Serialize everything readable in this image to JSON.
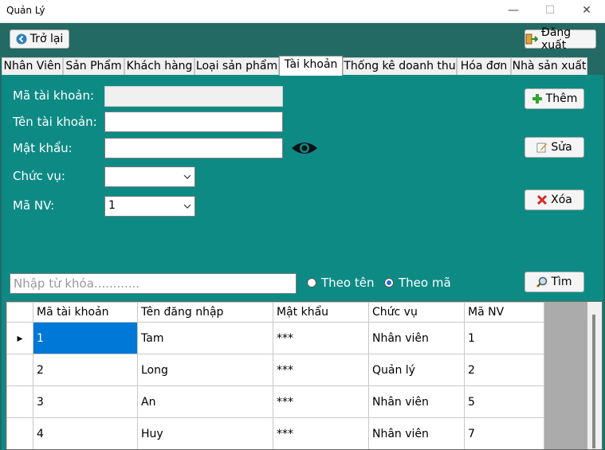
{
  "window": {
    "title": "Quản Lý",
    "minimize": "—",
    "maximize": "☐",
    "close": "✕"
  },
  "toolbar": {
    "back_label": "Trở lại",
    "logout_label": "Đăng xuất"
  },
  "tabs": [
    {
      "label": "Nhân Viên"
    },
    {
      "label": "Sản Phẩm"
    },
    {
      "label": "Khách hàng"
    },
    {
      "label": "Loại sản phẩm"
    },
    {
      "label": "Tài khoản"
    },
    {
      "label": "Thống kê doanh thu"
    },
    {
      "label": "Hóa đơn"
    },
    {
      "label": "Nhà sản xuất"
    }
  ],
  "active_tab": "Tài khoản",
  "form": {
    "account_id_label": "Mã tài khoản:",
    "account_id_value": "",
    "username_label": "Tên tài khoản:",
    "username_value": "",
    "password_label": "Mật khẩu:",
    "password_value": "",
    "role_label": "Chức vụ:",
    "role_value": "",
    "employee_id_label": "Mã NV:",
    "employee_id_value": "1"
  },
  "actions": {
    "add_label": "Thêm",
    "edit_label": "Sửa",
    "delete_label": "Xóa",
    "search_label": "Tìm"
  },
  "search": {
    "placeholder": "Nhập từ khóa............",
    "by_name_label": "Theo tên",
    "by_id_label": "Theo mã",
    "selected": "Theo mã"
  },
  "table": {
    "columns": [
      "Mã tài khoản",
      "Tên đăng nhập",
      "Mật khẩu",
      "Chức vụ",
      "Mã NV"
    ],
    "rows": [
      [
        "1",
        "Tam",
        "***",
        "Nhân viên",
        "1"
      ],
      [
        "2",
        "Long",
        "***",
        "Quản lý",
        "2"
      ],
      [
        "3",
        "An",
        "***",
        "Nhân viên",
        "5"
      ],
      [
        "4",
        "Huy",
        "***",
        "Nhân viên",
        "7"
      ]
    ],
    "current_row_marker": "▸"
  },
  "colors": {
    "panel": "#0e8a85",
    "header_bg": "#246a64",
    "selection": "#0078d7"
  }
}
